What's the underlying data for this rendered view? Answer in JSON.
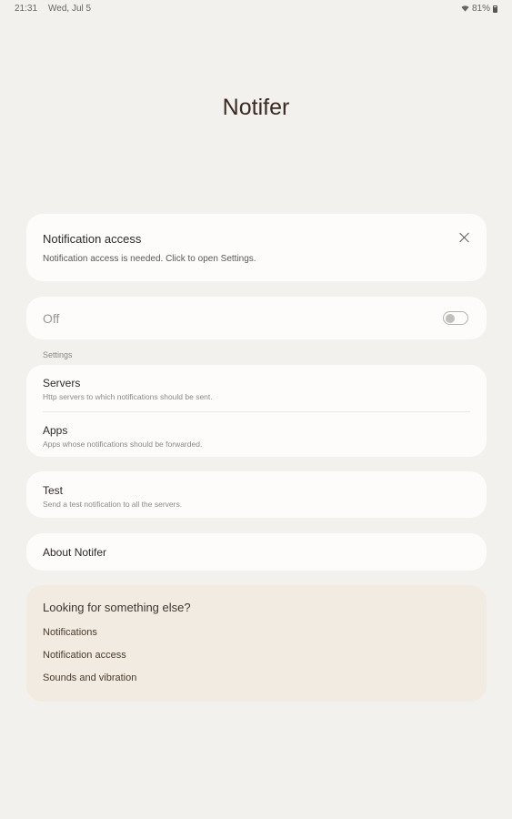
{
  "status_bar": {
    "time": "21:31",
    "date": "Wed, Jul 5",
    "battery": "81%"
  },
  "app": {
    "title": "Notifer"
  },
  "access_card": {
    "title": "Notification access",
    "description": "Notification access is needed. Click to open Settings."
  },
  "master_toggle": {
    "label": "Off",
    "state": false
  },
  "settings": {
    "section_label": "Settings",
    "items": [
      {
        "title": "Servers",
        "subtitle": "Http servers to which notifications should be sent."
      },
      {
        "title": "Apps",
        "subtitle": "Apps whose notifications should be forwarded."
      }
    ]
  },
  "test": {
    "title": "Test",
    "subtitle": "Send a test notification to all the servers."
  },
  "about": {
    "title": "About Notifer"
  },
  "suggestions": {
    "title": "Looking for something else?",
    "links": [
      "Notifications",
      "Notification access",
      "Sounds and vibration"
    ]
  },
  "colors": {
    "background": "#f3f1ee",
    "card": "#fdfcfb",
    "suggestion_card": "#f1ebe1",
    "title_text": "#3b2a22"
  }
}
